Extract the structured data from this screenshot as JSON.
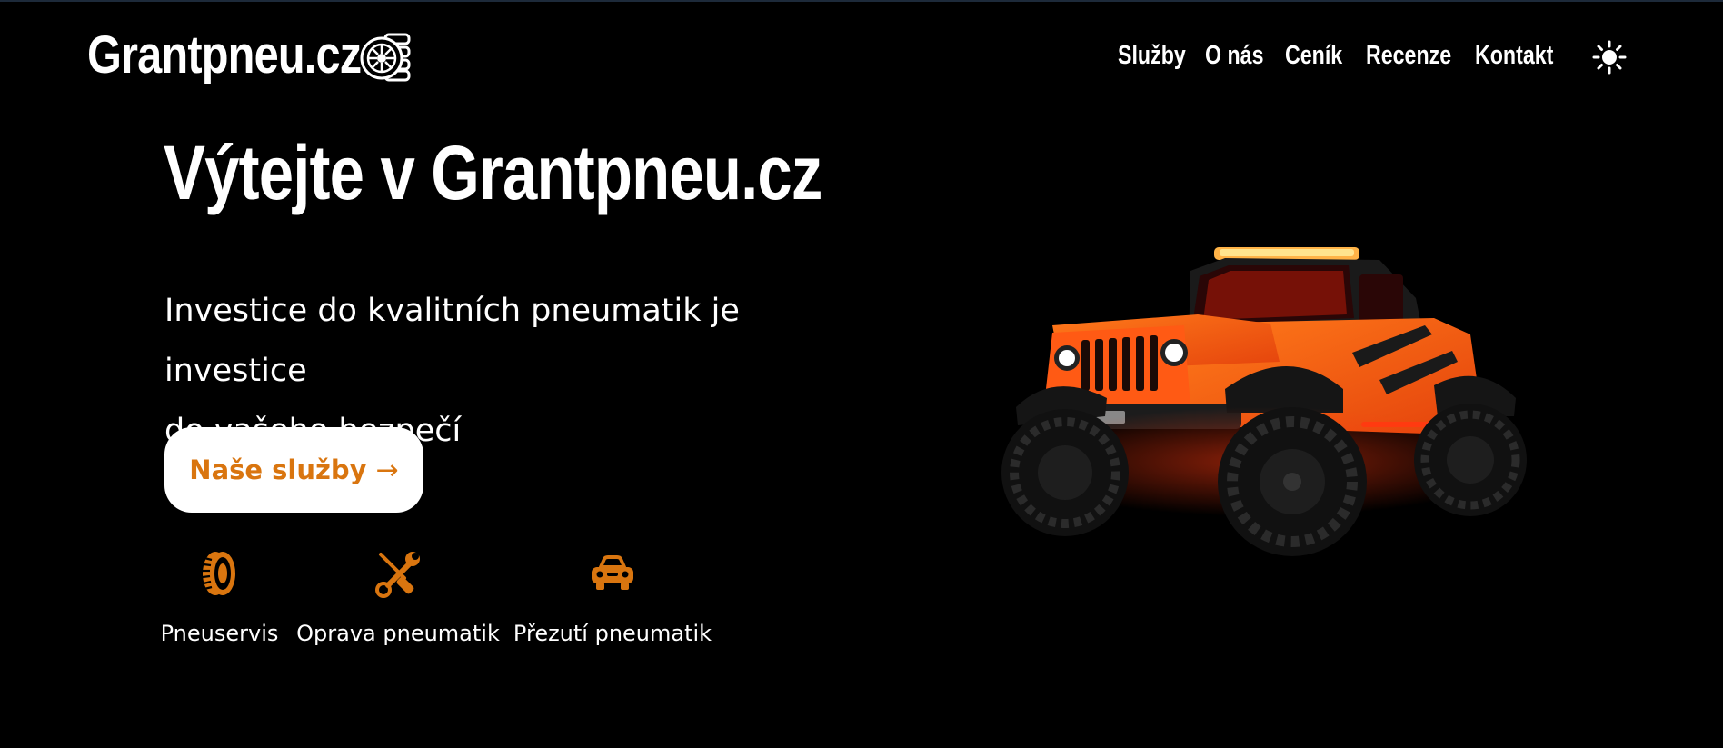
{
  "header": {
    "logo_text": "Grantpneu.cz",
    "logo_icon": "tire-stack-icon",
    "nav": [
      {
        "label": "Služby",
        "name": "nav-sluzby"
      },
      {
        "label": "O nás",
        "name": "nav-o-nas"
      },
      {
        "label": "Ceník",
        "name": "nav-cenik"
      },
      {
        "label": "Recenze",
        "name": "nav-recenze"
      },
      {
        "label": "Kontakt",
        "name": "nav-kontakt"
      }
    ],
    "theme_toggle_icon": "sun-icon"
  },
  "hero": {
    "title": "Výtejte v Grantpneu.cz",
    "subtitle_line1": "Investice do kvalitních pneumatik je investice",
    "subtitle_line2": "do vašeho bezpečí",
    "cta_label": "Naše služby",
    "cta_arrow": "→",
    "image": "orange-jeep-image"
  },
  "features": [
    {
      "label": "Pneuservis",
      "icon": "tire-icon"
    },
    {
      "label": "Oprava pneumatik",
      "icon": "wrench-screwdriver-icon"
    },
    {
      "label": "Přezutí pneumatik",
      "icon": "car-icon"
    }
  ],
  "colors": {
    "background": "#000000",
    "text": "#ffffff",
    "accent": "#d9750f",
    "button_bg": "#ffffff"
  }
}
